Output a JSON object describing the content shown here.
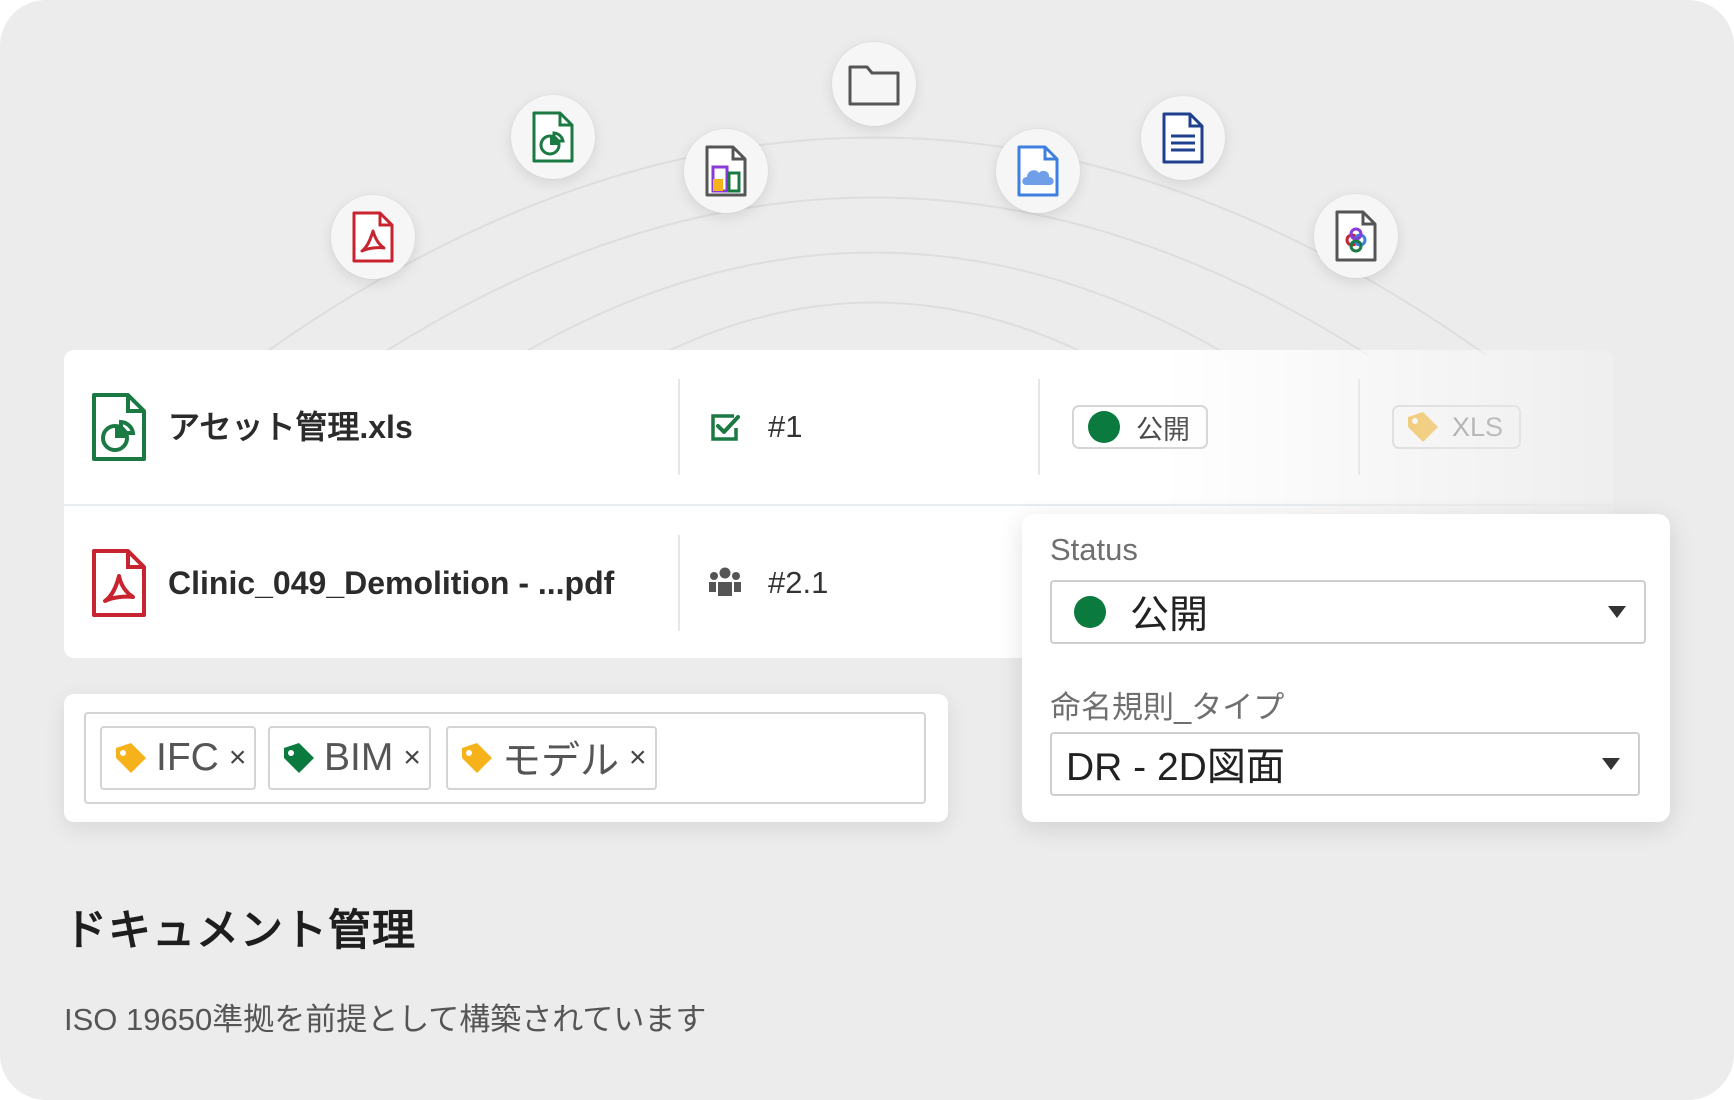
{
  "files": [
    {
      "name": "アセット管理.xls",
      "icon": "spreadsheet-chart-icon",
      "number": "#1",
      "number_icon": "checkbox-icon",
      "status": "公開",
      "tag": "XLS"
    },
    {
      "name": "Clinic_049_Demolition - ...pdf",
      "icon": "pdf-icon",
      "number": "#2.1",
      "number_icon": "people-group-icon"
    }
  ],
  "tags": [
    "IFC",
    "BIM",
    "モデル"
  ],
  "remove_symbol": "×",
  "dropdown": {
    "status_label": "Status",
    "status_value": "公開",
    "naming_label": "命名規則_タイプ",
    "naming_value": "DR - 2D図面"
  },
  "feature": {
    "title": "ドキュメント管理",
    "subtitle": "ISO 19650準拠を前提として構築されています"
  },
  "colors": {
    "status_green": "#0a7a3f",
    "pdf_red": "#c8242f",
    "sheet_green": "#1b7a43",
    "tag_yellow": "#f6b21a",
    "tag_green": "#0a7a3f"
  },
  "orbit_icons": [
    "pdf-icon",
    "spreadsheet-chart-icon",
    "report-chart-icon",
    "folder-icon",
    "cloud-file-icon",
    "document-text-icon",
    "bim-file-icon"
  ]
}
